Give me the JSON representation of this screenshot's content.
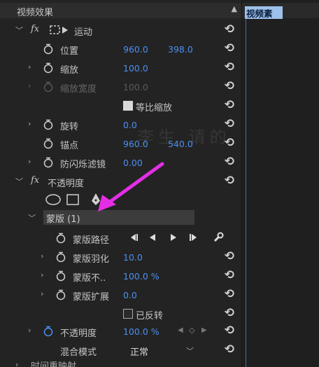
{
  "panel_title": "视频效果",
  "timeline_clip": "视频素",
  "watermark": "李生 请的 先生",
  "rows": {
    "motion": {
      "label": "运动"
    },
    "position": {
      "label": "位置",
      "v1": "960.0",
      "v2": "398.0"
    },
    "scale": {
      "label": "缩放",
      "v1": "100.0"
    },
    "scale_width": {
      "label": "缩放宽度",
      "v1": "100.0"
    },
    "uniform": {
      "label": "等比缩放"
    },
    "rotation": {
      "label": "旋转",
      "v1": "0.0"
    },
    "anchor": {
      "label": "锚点",
      "v1": "960.0",
      "v2": "540.0"
    },
    "flicker": {
      "label": "防闪烁滤镜",
      "v1": "0.00"
    },
    "opacity_fx": {
      "label": "不透明度"
    },
    "mask": {
      "label": "蒙版 (1)"
    },
    "mask_path": {
      "label": "蒙版路径"
    },
    "mask_feather": {
      "label": "蒙版羽化",
      "v1": "10.0"
    },
    "mask_opacity": {
      "label": "蒙版不..",
      "v1": "100.0 %"
    },
    "mask_expand": {
      "label": "蒙版扩展",
      "v1": "0.0"
    },
    "inverted": {
      "label": "已反转"
    },
    "opacity": {
      "label": "不透明度",
      "v1": "100.0 %"
    },
    "blend": {
      "label": "混合模式",
      "v1": "正常"
    },
    "remap": {
      "label": "时间重映射"
    }
  },
  "colors": {
    "value_blue": "#4c8ff0",
    "arrow_magenta": "#e42ee6",
    "clip_bg": "#9dc1ea"
  }
}
